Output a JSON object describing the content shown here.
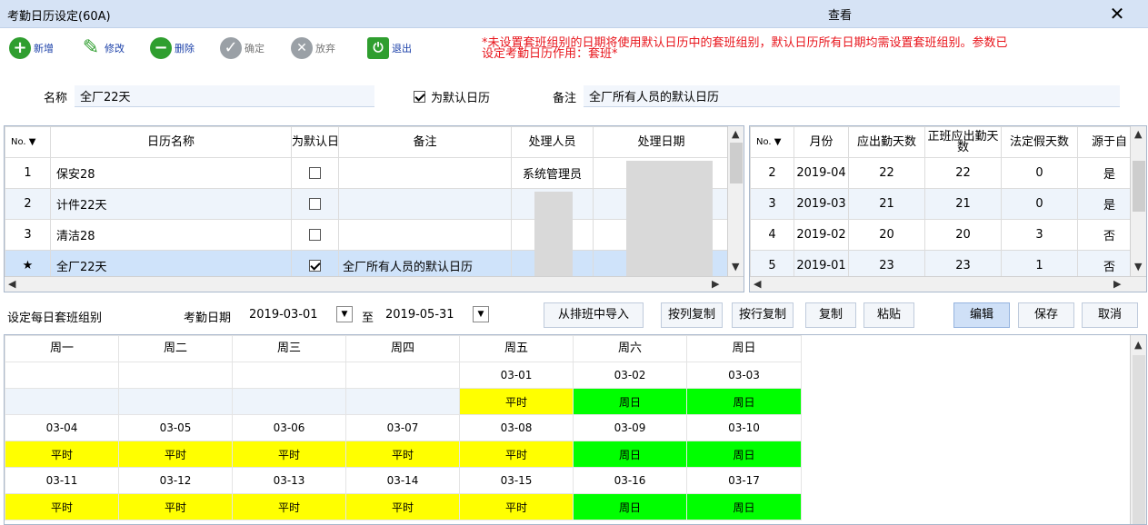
{
  "window": {
    "title": "考勤日历设定(60A)",
    "mode": "查看",
    "close": "✕"
  },
  "toolbar": {
    "add": "新增",
    "edit": "修改",
    "delete": "删除",
    "confirm": "确定",
    "discard": "放弃",
    "exit": "退出",
    "notice_line1": "*未设置套班组别的日期将使用默认日历中的套班组别，默认日历所有日期均需设置套班组别。参数已",
    "notice_line2": "设定考勤日历作用：套班*"
  },
  "form": {
    "name_label": "名称",
    "name_value": "全厂22天",
    "default_label": "为默认日历",
    "default_checked": true,
    "remark_label": "备注",
    "remark_value": "全厂所有人员的默认日历"
  },
  "calendar_grid": {
    "headers": [
      "No.",
      "日历名称",
      "为默认日历",
      "备注",
      "处理人员",
      "处理日期"
    ],
    "rows": [
      {
        "no": "1",
        "name": "保安28",
        "default": false,
        "remark": "",
        "handler": "系统管理员",
        "date": "",
        "selected": false
      },
      {
        "no": "2",
        "name": "计件22天",
        "default": false,
        "remark": "",
        "handler": "",
        "date": "",
        "selected": false
      },
      {
        "no": "3",
        "name": "清洁28",
        "default": false,
        "remark": "",
        "handler": "",
        "date": "",
        "selected": false
      },
      {
        "no": "★",
        "name": "全厂22天",
        "default": true,
        "remark": "全厂所有人员的默认日历",
        "handler": "",
        "date": "",
        "selected": true
      }
    ]
  },
  "month_grid": {
    "headers": [
      "No.",
      "月份",
      "应出勤天数",
      "正班应出勤天数",
      "法定假天数",
      "源于自"
    ],
    "rows": [
      {
        "no": "2",
        "month": "2019-04",
        "due": "22",
        "reg": "22",
        "holiday": "0",
        "source": "是"
      },
      {
        "no": "3",
        "month": "2019-03",
        "due": "21",
        "reg": "21",
        "holiday": "0",
        "source": "是"
      },
      {
        "no": "4",
        "month": "2019-02",
        "due": "20",
        "reg": "20",
        "holiday": "3",
        "source": "否"
      },
      {
        "no": "5",
        "month": "2019-01",
        "due": "23",
        "reg": "23",
        "holiday": "1",
        "source": "否"
      }
    ]
  },
  "lower": {
    "section_label": "设定每日套班组别",
    "date_label": "考勤日期",
    "date_from": "2019-03-01",
    "to": "至",
    "date_to": "2019-05-31",
    "import": "从排班中导入",
    "copy_col": "按列复制",
    "copy_row": "按行复制",
    "copy": "复制",
    "paste": "粘贴",
    "edit": "编辑",
    "save": "保存",
    "cancel": "取消"
  },
  "schedule": {
    "weekdays": [
      "周一",
      "周二",
      "周三",
      "周四",
      "周五",
      "周六",
      "周日"
    ],
    "weeks": [
      {
        "dates": [
          "",
          "",
          "",
          "",
          "03-01",
          "03-02",
          "03-03"
        ],
        "types": [
          "",
          "",
          "",
          "",
          "平时",
          "周日",
          "周日"
        ]
      },
      {
        "dates": [
          "03-04",
          "03-05",
          "03-06",
          "03-07",
          "03-08",
          "03-09",
          "03-10"
        ],
        "types": [
          "平时",
          "平时",
          "平时",
          "平时",
          "平时",
          "周日",
          "周日"
        ]
      },
      {
        "dates": [
          "03-11",
          "03-12",
          "03-13",
          "03-14",
          "03-15",
          "03-16",
          "03-17"
        ],
        "types": [
          "平时",
          "平时",
          "平时",
          "平时",
          "平时",
          "周日",
          "周日"
        ]
      }
    ],
    "colors": {
      "weekday": "#ffff00",
      "weekend": "#00ff00"
    }
  }
}
